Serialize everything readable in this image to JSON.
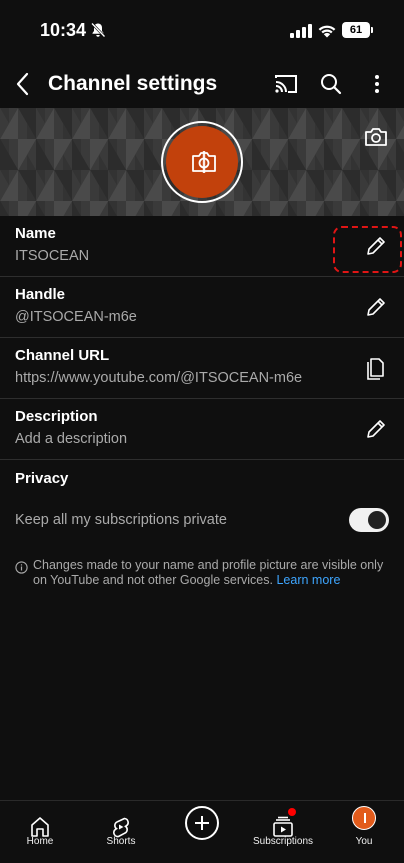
{
  "status_bar": {
    "time": "10:34",
    "battery": "61"
  },
  "header": {
    "title": "Channel settings"
  },
  "rows": [
    {
      "label": "Name",
      "value": "ITSOCEAN",
      "action_icon": "pencil-icon"
    },
    {
      "label": "Handle",
      "value": "@ITSOCEAN-m6e",
      "action_icon": "pencil-icon"
    },
    {
      "label": "Channel URL",
      "value": "https://www.youtube.com/@ITSOCEAN-m6e",
      "action_icon": "copy-icon"
    },
    {
      "label": "Description",
      "value": "Add a description",
      "action_icon": "pencil-icon"
    }
  ],
  "privacy": {
    "title": "Privacy",
    "toggle_label": "Keep all my subscriptions private",
    "toggle_on": true
  },
  "info": {
    "text": "Changes made to your name and profile picture are visible only on YouTube and not other Google services.",
    "link": "Learn more"
  },
  "bottom_nav": [
    {
      "label": "Home",
      "icon": "home-icon"
    },
    {
      "label": "Shorts",
      "icon": "shorts-icon"
    },
    {
      "label": "",
      "icon": "create-icon"
    },
    {
      "label": "Subscriptions",
      "icon": "subscriptions-icon"
    },
    {
      "label": "You",
      "icon": "avatar-icon"
    }
  ],
  "colors": {
    "background": "#0f0f0f",
    "avatar": "#c2410c",
    "link": "#3ea6ff",
    "highlight": "#e01515"
  }
}
